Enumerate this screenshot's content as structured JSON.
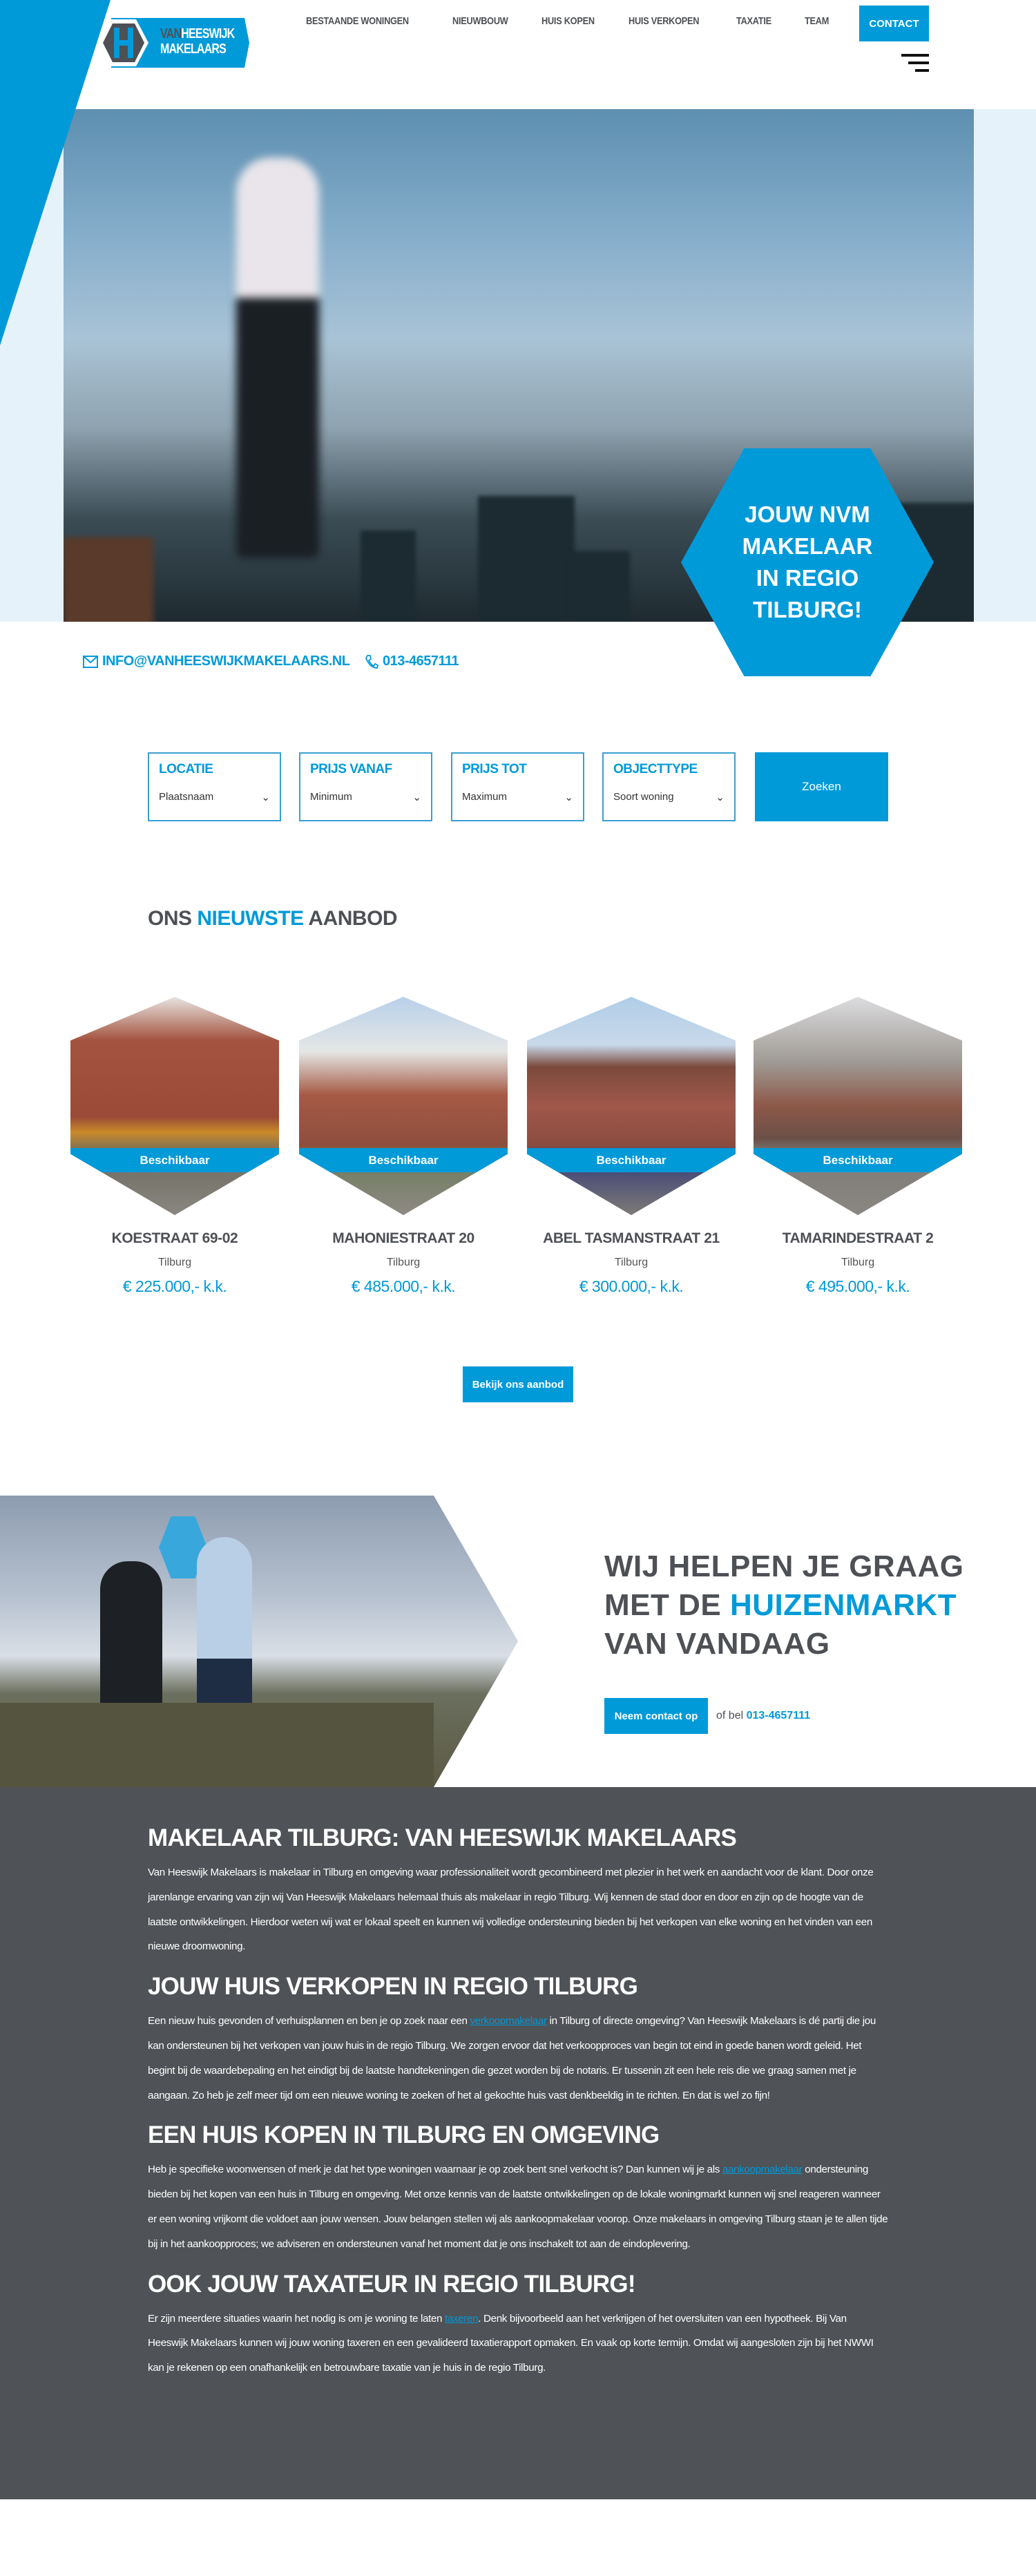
{
  "brand": {
    "logo_line1a": "VAN",
    "logo_line1b": "HEESWIJK",
    "logo_line2": "MAKELAARS",
    "accent": "#009ad9",
    "dark": "#4f5256"
  },
  "nav": {
    "items": [
      "BESTAANDE WONINGEN",
      "NIEUWBOUW",
      "HUIS KOPEN",
      "HUIS VERKOPEN",
      "TAXATIE",
      "TEAM"
    ],
    "contact": "CONTACT",
    "menu_icon": "hamburger-icon"
  },
  "hero": {
    "badge_lines": [
      "JOUW NVM",
      "MAKELAAR",
      "IN REGIO",
      "TILBURG!"
    ]
  },
  "contact": {
    "email": "INFO@VANHEESWIJKMAKELAARS.NL",
    "phone": "013-4657111"
  },
  "search": {
    "fields": [
      {
        "label": "LOCATIE",
        "value": "Plaatsnaam"
      },
      {
        "label": "PRIJS VANAF",
        "value": "Minimum"
      },
      {
        "label": "PRIJS TOT",
        "value": "Maximum"
      },
      {
        "label": "OBJECTTYPE",
        "value": "Soort woning"
      }
    ],
    "button": "Zoeken"
  },
  "listings": {
    "title_a": "ONS ",
    "title_b": "NIEUWSTE",
    "title_c": " AANBOD",
    "status": "Beschikbaar",
    "items": [
      {
        "title": "KOESTRAAT 69-02",
        "city": "Tilburg",
        "price": "€ 225.000,- k.k."
      },
      {
        "title": "MAHONIESTRAAT 20",
        "city": "Tilburg",
        "price": "€ 485.000,- k.k."
      },
      {
        "title": "ABEL TASMANSTRAAT 21",
        "city": "Tilburg",
        "price": "€ 300.000,- k.k."
      },
      {
        "title": "TAMARINDESTRAAT 2",
        "city": "Tilburg",
        "price": "€ 495.000,- k.k."
      }
    ],
    "button": "Bekijk ons aanbod"
  },
  "cta": {
    "line1": "WIJ HELPEN JE GRAAG",
    "line2a": "MET DE ",
    "line2b": "HUIZENMARKT",
    "line3": "VAN VANDAAG",
    "button": "Neem contact op",
    "or_call": "of bel ",
    "phone": "013-4657111"
  },
  "content": {
    "h1": "MAKELAAR TILBURG: VAN HEESWIJK MAKELAARS",
    "p1": "Van Heeswijk Makelaars is makelaar in Tilburg en omgeving waar professionaliteit wordt gecombineerd met plezier in het werk en aandacht voor de klant. Door onze jarenlange ervaring van zijn wij Van Heeswijk Makelaars helemaal thuis als makelaar in regio Tilburg. Wij kennen de stad door en door en zijn op de hoogte van de laatste ontwikkelingen. Hierdoor weten wij wat er lokaal speelt en kunnen wij volledige ondersteuning bieden bij het verkopen van elke woning en het vinden van een nieuwe droomwoning.",
    "h2": "JOUW HUIS VERKOPEN IN REGIO TILBURG",
    "p2a": "Een nieuw huis gevonden of verhuisplannen en ben je op zoek naar een ",
    "p2link": "verkoopmakelaar",
    "p2b": " in Tilburg of directe omgeving? Van Heeswijk Makelaars is dé partij die jou kan ondersteunen bij het verkopen van jouw huis in de regio Tilburg. We zorgen ervoor dat het verkoopproces van begin tot eind in goede banen wordt geleid. Het begint bij de waardebepaling en het eindigt bij de laatste handtekeningen die gezet worden bij de notaris. Er tussenin zit een hele reis die we graag samen met je aangaan. Zo heb je zelf meer tijd om een nieuwe woning te zoeken of het al gekochte huis vast denkbeeldig in te richten. En dat is wel zo fijn!",
    "h3": "EEN HUIS KOPEN IN TILBURG EN OMGEVING",
    "p3a": "Heb je specifieke woonwensen of merk je dat het type woningen waarnaar je op zoek bent snel verkocht is? Dan kunnen wij je als ",
    "p3link": "aankoopmakelaar",
    "p3b": " ondersteuning bieden bij het kopen van een huis in Tilburg en omgeving. Met onze kennis van de laatste ontwikkelingen op de lokale woningmarkt kunnen wij snel reageren wanneer er een woning vrijkomt die voldoet aan jouw wensen. Jouw belangen stellen wij als aankoopmakelaar voorop. Onze makelaars in omgeving Tilburg staan je te allen tijde bij in het aankoopproces; we adviseren en ondersteunen vanaf het moment dat je ons inschakelt tot aan de eindoplevering.",
    "h4": "OOK JOUW TAXATEUR IN REGIO TILBURG!",
    "p4a": "Er zijn meerdere situaties waarin het nodig is om je woning te laten ",
    "p4link": "taxeren",
    "p4b": ". Denk bijvoorbeeld aan het verkrijgen of het oversluiten van een hypotheek. Bij Van Heeswijk Makelaars kunnen wij jouw woning taxeren en een gevalideerd taxatierapport opmaken. En vaak op korte termijn. Omdat wij aangesloten zijn bij het NWWI kan je rekenen op een onafhankelijk en betrouwbare taxatie van je huis in de regio Tilburg."
  }
}
